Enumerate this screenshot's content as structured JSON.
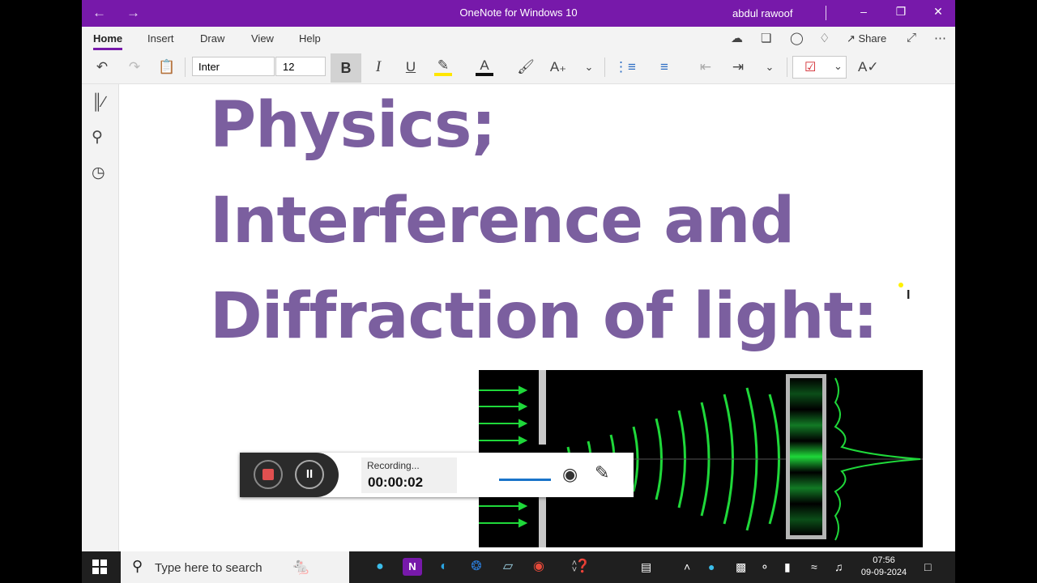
{
  "window": {
    "title": "OneNote for Windows 10",
    "user": "abdul rawoof"
  },
  "ribbon": {
    "tabs": [
      "Home",
      "Insert",
      "Draw",
      "View",
      "Help"
    ],
    "share_label": "Share",
    "font_name": "Inter",
    "font_size": "12"
  },
  "page": {
    "heading_lines": [
      "Physics;",
      "Interference and",
      "Diffraction of light:"
    ]
  },
  "recorder": {
    "status": "Recording...",
    "time": "00:00:02"
  },
  "taskbar": {
    "search_placeholder": "Type here to search",
    "time": "07:56",
    "date": "09-09-2024"
  },
  "colors": {
    "titlebar": "#7719aa",
    "heading": "#7b5f9f",
    "diagram_wave": "#1fd83a"
  }
}
